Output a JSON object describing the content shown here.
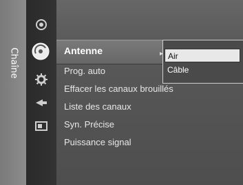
{
  "category": {
    "label": "Chaîne"
  },
  "menu": {
    "items": [
      {
        "label": "Antenne",
        "selected": true
      },
      {
        "label": "Prog. auto"
      },
      {
        "label": "Effacer les canaux brouillés"
      },
      {
        "label": "Liste des canaux"
      },
      {
        "label": "Syn. Précise"
      },
      {
        "label": "Puissance signal"
      }
    ]
  },
  "popup": {
    "options": [
      {
        "label": "Air",
        "selected": true
      },
      {
        "label": "Câble"
      }
    ]
  },
  "icons": [
    "picture-icon",
    "channel-icon",
    "setup-icon",
    "input-icon",
    "application-icon"
  ],
  "colors": {
    "selected_option_bg": "#e8e8e8",
    "panel_bg": "#555555"
  }
}
